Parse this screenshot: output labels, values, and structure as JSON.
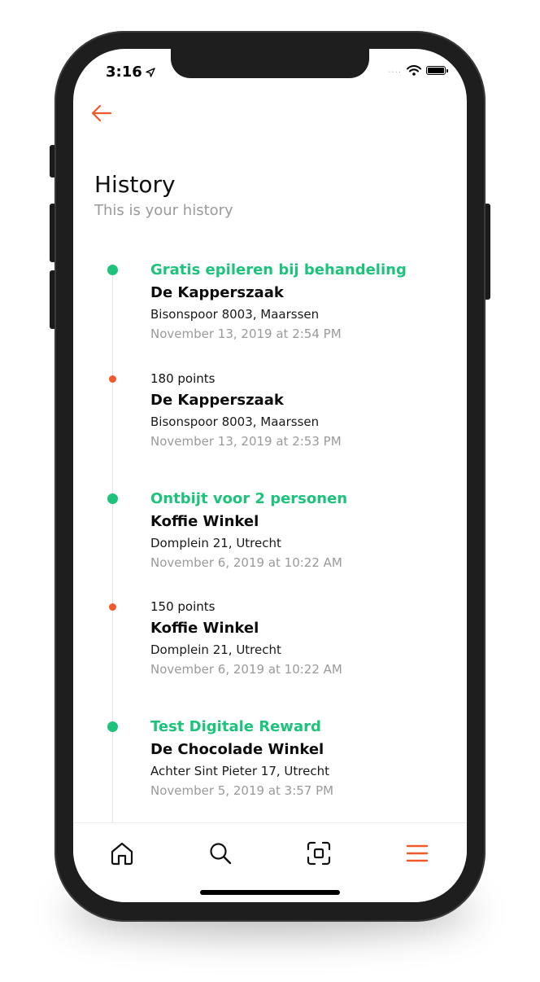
{
  "status_bar": {
    "time": "3:16",
    "signal": "....",
    "icons": [
      "location-arrow-icon",
      "wifi-icon",
      "battery-icon"
    ]
  },
  "header": {
    "back_icon": "arrow-left-icon",
    "title": "History",
    "subtitle": "This is your history"
  },
  "colors": {
    "accent": "#F05A28",
    "reward_green": "#1DC37A",
    "timeline_line": "#E4E4E4",
    "muted_text": "#9A9A9A"
  },
  "history": [
    {
      "type": "reward",
      "headline": "Gratis epileren bij behandeling",
      "shop": "De Kapperszaak",
      "address": "Bisonspoor 8003, Maarssen",
      "datetime": "November 13, 2019 at 2:54 PM"
    },
    {
      "type": "points",
      "headline": "180 points",
      "shop": "De Kapperszaak",
      "address": "Bisonspoor 8003, Maarssen",
      "datetime": "November 13, 2019 at 2:53 PM"
    },
    {
      "type": "reward",
      "headline": "Ontbijt voor 2 personen",
      "shop": "Koffie Winkel",
      "address": "Domplein 21, Utrecht",
      "datetime": "November 6, 2019 at 10:22 AM"
    },
    {
      "type": "points",
      "headline": "150 points",
      "shop": "Koffie Winkel",
      "address": "Domplein 21, Utrecht",
      "datetime": "November 6, 2019 at 10:22 AM"
    },
    {
      "type": "reward",
      "headline": "Test Digitale Reward",
      "shop": "De Chocolade Winkel",
      "address": "Achter Sint Pieter 17, Utrecht",
      "datetime": "November 5, 2019 at 3:57 PM"
    }
  ],
  "tabbar": {
    "tabs": [
      {
        "icon": "home-icon",
        "active": false
      },
      {
        "icon": "search-icon",
        "active": false
      },
      {
        "icon": "scan-icon",
        "active": false
      },
      {
        "icon": "menu-icon",
        "active": true
      }
    ]
  }
}
